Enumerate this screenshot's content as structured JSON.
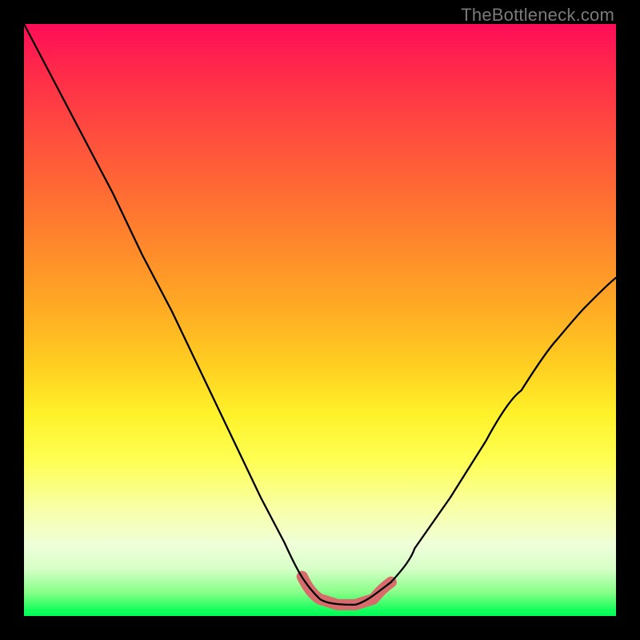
{
  "watermark": "TheBottleneck.com",
  "colors": {
    "frame_bg": "#000000",
    "curve": "#000000",
    "valley_accent": "#d86b6b",
    "gradient_top": "#ff0d58",
    "gradient_bottom": "#00ff55"
  },
  "chart_data": {
    "type": "line",
    "title": "",
    "xlabel": "",
    "ylabel": "",
    "xlim": [
      0,
      100
    ],
    "ylim": [
      0,
      105
    ],
    "grid": false,
    "legend": false,
    "series": [
      {
        "name": "bottleneck-curve",
        "x": [
          0,
          5,
          10,
          15,
          20,
          25,
          30,
          35,
          40,
          44,
          47,
          50,
          53,
          56,
          59,
          62,
          66,
          72,
          78,
          84,
          90,
          95,
          100
        ],
        "y": [
          105,
          95,
          85,
          75,
          64,
          54,
          43,
          32,
          21,
          13,
          7,
          3,
          2,
          2,
          3,
          6,
          12,
          21,
          31,
          40,
          49,
          55,
          60
        ]
      }
    ],
    "valley_highlight": {
      "x_start": 47,
      "x_end": 59,
      "y": 2,
      "note": "flat valley segment emphasized with thick salmon stroke"
    }
  }
}
